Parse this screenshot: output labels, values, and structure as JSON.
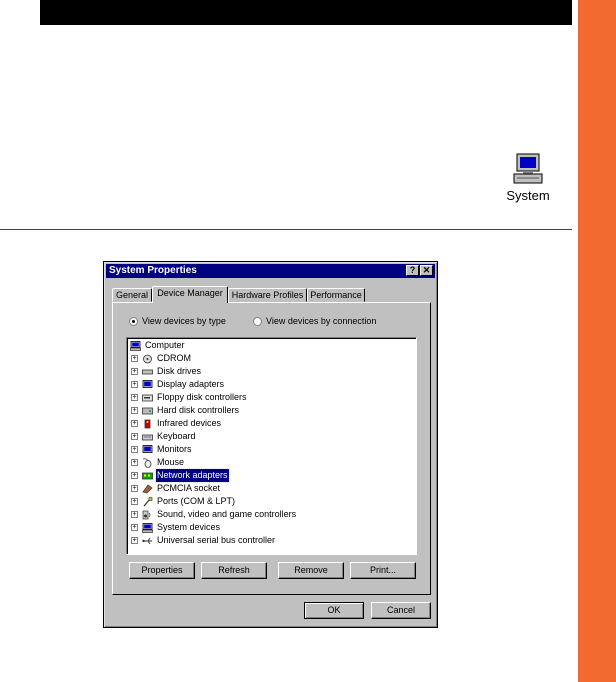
{
  "desktop": {
    "icon_label": "System"
  },
  "dialog": {
    "title": "System Properties",
    "help_button": "?",
    "close_button": "✕",
    "tabs": [
      {
        "label": "General"
      },
      {
        "label": "Device Manager"
      },
      {
        "label": "Hardware Profiles"
      },
      {
        "label": "Performance"
      }
    ],
    "view_options": [
      {
        "label": "View devices by type",
        "selected": true
      },
      {
        "label": "View devices by connection",
        "selected": false
      }
    ],
    "tree": {
      "root": "Computer",
      "items": [
        {
          "label": "CDROM",
          "icon": "cdrom-icon"
        },
        {
          "label": "Disk drives",
          "icon": "disk-drive-icon"
        },
        {
          "label": "Display adapters",
          "icon": "display-adapter-icon"
        },
        {
          "label": "Floppy disk controllers",
          "icon": "floppy-controller-icon"
        },
        {
          "label": "Hard disk controllers",
          "icon": "hard-disk-controller-icon"
        },
        {
          "label": "Infrared devices",
          "icon": "infrared-icon"
        },
        {
          "label": "Keyboard",
          "icon": "keyboard-icon"
        },
        {
          "label": "Monitors",
          "icon": "monitor-icon"
        },
        {
          "label": "Mouse",
          "icon": "mouse-icon"
        },
        {
          "label": "Network adapters",
          "icon": "network-adapter-icon",
          "selected": true
        },
        {
          "label": "PCMCIA socket",
          "icon": "pcmcia-icon"
        },
        {
          "label": "Ports (COM & LPT)",
          "icon": "ports-icon"
        },
        {
          "label": "Sound, video and game controllers",
          "icon": "sound-icon"
        },
        {
          "label": "System devices",
          "icon": "system-devices-icon"
        },
        {
          "label": "Universal serial bus controller",
          "icon": "usb-icon"
        }
      ]
    },
    "buttons": {
      "properties": "Properties",
      "refresh": "Refresh",
      "remove": "Remove",
      "print": "Print...",
      "ok": "OK",
      "cancel": "Cancel"
    }
  }
}
